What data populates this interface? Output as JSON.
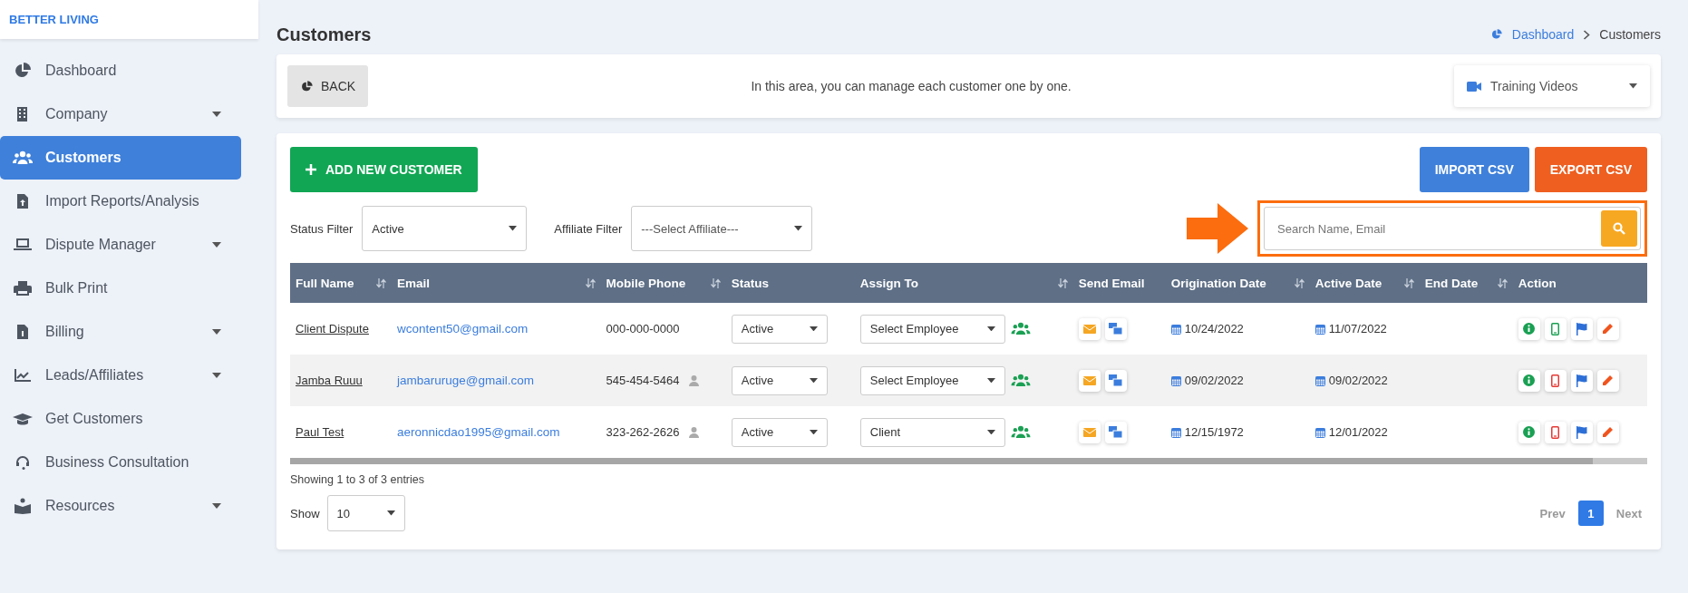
{
  "brand": "BETTER LIVING",
  "sidebar": {
    "items": [
      {
        "label": "Dashboard",
        "has_dropdown": false,
        "selected": false
      },
      {
        "label": "Company",
        "has_dropdown": true,
        "selected": false
      },
      {
        "label": "Customers",
        "has_dropdown": false,
        "selected": true
      },
      {
        "label": "Import Reports/Analysis",
        "has_dropdown": false,
        "selected": false
      },
      {
        "label": "Dispute Manager",
        "has_dropdown": true,
        "selected": false
      },
      {
        "label": "Bulk Print",
        "has_dropdown": false,
        "selected": false
      },
      {
        "label": "Billing",
        "has_dropdown": true,
        "selected": false
      },
      {
        "label": "Leads/Affiliates",
        "has_dropdown": true,
        "selected": false
      },
      {
        "label": "Get Customers",
        "has_dropdown": false,
        "selected": false
      },
      {
        "label": "Business Consultation",
        "has_dropdown": false,
        "selected": false
      },
      {
        "label": "Resources",
        "has_dropdown": true,
        "selected": false
      }
    ]
  },
  "page_title": "Customers",
  "breadcrumb": [
    "Dashboard",
    "Customers"
  ],
  "info_bar": {
    "back_button": "BACK",
    "message": "In this area, you can manage each customer one by one.",
    "videos_dropdown": "Training Videos"
  },
  "toolbar": {
    "add_button": "ADD NEW CUSTOMER",
    "import_button": "IMPORT CSV",
    "export_button": "EXPORT CSV"
  },
  "filters": [
    {
      "label": "Status Filter",
      "value": "Active"
    },
    {
      "label": "Affiliate Filter",
      "value": "---Select Affiliate---"
    }
  ],
  "search": {
    "placeholder": "Search Name, Email",
    "highlighted": true
  },
  "table": {
    "columns": [
      {
        "label": "Full Name",
        "sortable": true
      },
      {
        "label": "Email",
        "sortable": true
      },
      {
        "label": "Mobile Phone",
        "sortable": true
      },
      {
        "label": "Status",
        "sortable": false
      },
      {
        "label": "Assign To",
        "sortable": true
      },
      {
        "label": "Send Email",
        "sortable": false
      },
      {
        "label": "Origination Date",
        "sortable": true
      },
      {
        "label": "Active Date",
        "sortable": true
      },
      {
        "label": "End Date",
        "sortable": true
      },
      {
        "label": "Action",
        "sortable": false
      }
    ],
    "rows": [
      {
        "name": "Client Dispute",
        "email": "wcontent50@gmail.com",
        "phone": "000-000-0000",
        "has_contact": false,
        "status": "Active",
        "assign_to": "Select Employee",
        "origination_date": "10/24/2022",
        "active_date": "11/07/2022",
        "color": "#1aa053"
      },
      {
        "name": "Jamba Ruuu",
        "email": "jambaruruge@gmail.com",
        "phone": "545-454-5464",
        "has_contact": true,
        "status": "Active",
        "assign_to": "Select Employee",
        "origination_date": "09/02/2022",
        "active_date": "09/02/2022",
        "color": "#e53935"
      },
      {
        "name": "Paul Test",
        "email": "aeronnicdao1995@gmail.com",
        "phone": "323-262-2626",
        "has_contact": true,
        "status": "Active",
        "assign_to": "Client",
        "origination_date": "12/15/1972",
        "active_date": "12/01/2022",
        "color": "#e53935"
      }
    ]
  },
  "entries_info": "Showing 1 to 3 of 3 entries",
  "page_size": {
    "label": "Show",
    "value": "10"
  },
  "pagination": {
    "prev": "Prev",
    "pages": [
      {
        "label": "1",
        "selected": true
      }
    ],
    "next": "Next"
  }
}
